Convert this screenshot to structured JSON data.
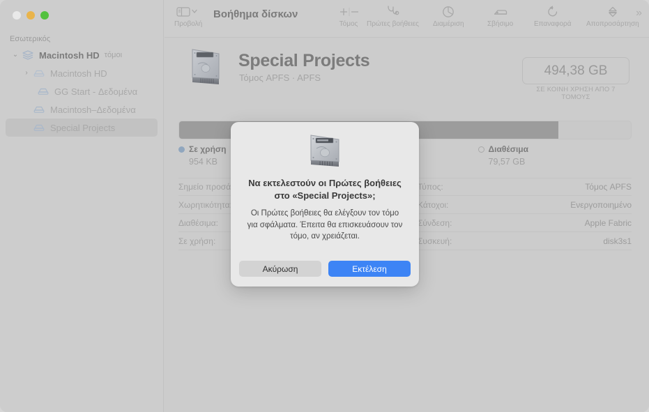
{
  "window": {
    "traffic_lights": [
      "close",
      "minimize",
      "maximize"
    ]
  },
  "toolbar": {
    "app_title": "Βοήθημα δίσκων",
    "view_label": "Προβολή",
    "items": [
      {
        "label": "Τόμος",
        "icon": "plus-minus-icon"
      },
      {
        "label": "Πρώτες βοήθειες",
        "icon": "stethoscope-icon"
      },
      {
        "label": "Διαμέριση",
        "icon": "pie-chart-icon"
      },
      {
        "label": "Σβήσιμο",
        "icon": "eraser-icon"
      },
      {
        "label": "Επαναφορά",
        "icon": "restore-icon"
      },
      {
        "label": "Αποπροσάρτηση",
        "icon": "eject-icon"
      }
    ],
    "overflow": "»"
  },
  "sidebar": {
    "header": "Εσωτερικός",
    "items": [
      {
        "label": "Macintosh HD",
        "sublabel": "τόμοι",
        "level": 1,
        "twisty": "⌄",
        "bold": true,
        "icon": "stack-icon",
        "selected": false
      },
      {
        "label": "Macintosh HD",
        "sublabel": "",
        "level": 2,
        "twisty": "›",
        "bold": false,
        "icon": "drive-icon",
        "selected": false
      },
      {
        "label": "GG Start - Δεδομένα",
        "sublabel": "",
        "level": 3,
        "twisty": "",
        "bold": false,
        "icon": "drive-icon",
        "selected": false
      },
      {
        "label": "Macintosh–Δεδομένα",
        "sublabel": "",
        "level": 2,
        "twisty": "",
        "bold": false,
        "icon": "drive-icon",
        "selected": false
      },
      {
        "label": "Special Projects",
        "sublabel": "",
        "level": 2,
        "twisty": "",
        "bold": false,
        "icon": "drive-icon",
        "selected": true
      }
    ]
  },
  "main": {
    "volume_title": "Special Projects",
    "volume_subtitle": "Τόμος APFS · APFS",
    "capacity_value": "494,38 GB",
    "capacity_caption": "ΣΕ ΚΟΙΝΗ ΧΡΗΣΗ ΑΠΟ 7 ΤΟΜΟΥΣ",
    "bar": {
      "used_percent": 84,
      "free_percent": 16,
      "used_color": "#9c9c9c",
      "free_color": "#c9c9c9"
    },
    "legend": [
      {
        "name": "Σε χρήση",
        "value": "954 KB",
        "swatch": "used"
      },
      {
        "name": "Διαθέσιμα",
        "value": "79,57 GB",
        "swatch": "free"
      }
    ],
    "details_left": [
      {
        "key": "Σημείο προσάρτησης:",
        "value": ""
      },
      {
        "key": "Χωρητικότητα:",
        "value": ""
      },
      {
        "key": "Διαθέσιμα:",
        "value": ""
      },
      {
        "key": "Σε χρήση:",
        "value": ""
      }
    ],
    "details_right": [
      {
        "key": "Τύπος:",
        "value": "Τόμος APFS"
      },
      {
        "key": "Κάτοχοι:",
        "value": "Ενεργοποιημένο"
      },
      {
        "key": "Σύνδεση:",
        "value": "Apple Fabric"
      },
      {
        "key": "Συσκευή:",
        "value": "disk3s1"
      }
    ]
  },
  "dialog": {
    "icon": "hard-drive-icon",
    "title": "Να εκτελεστούν οι Πρώτες βοήθειες στο «Special Projects»;",
    "body": "Οι Πρώτες βοήθειες θα ελέγξουν τον τόμο για σφάλματα. Έπειτα θα επισκευάσουν τον τόμο, αν χρειάζεται.",
    "cancel_label": "Ακύρωση",
    "confirm_label": "Εκτέλεση",
    "confirm_color": "#3d84f5"
  }
}
